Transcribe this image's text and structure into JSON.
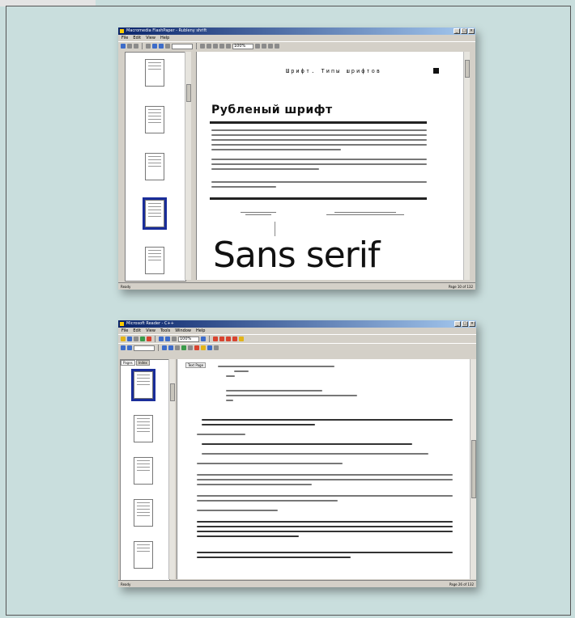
{
  "window1": {
    "title": "Macromedia FlashPaper - Rubleny shrift",
    "menu": [
      "File",
      "Edit",
      "View",
      "Help"
    ],
    "zoom_value": "100%",
    "page": {
      "chapter_header": "Шрифт. Типы шрифтов",
      "heading": "Рубленый шрифт",
      "big_sample": "Sans serif"
    },
    "statusbar": {
      "left": "Ready",
      "right": "Page 10 of 132"
    }
  },
  "window2": {
    "title": "Microsoft Reader - C++",
    "menu": [
      "File",
      "Edit",
      "View",
      "Tools",
      "Window",
      "Help"
    ],
    "zoom_value": "100%",
    "sidebar_tabs": [
      "Pages",
      "Index"
    ],
    "doc_tag": "Text Page",
    "statusbar": {
      "left": "Ready",
      "right": "Page 26 of 132"
    }
  }
}
